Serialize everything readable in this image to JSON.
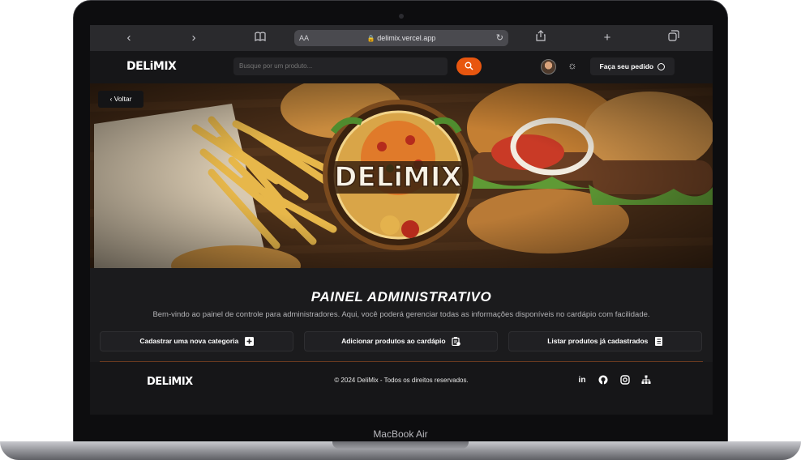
{
  "device": {
    "label": "MacBook Air"
  },
  "browser": {
    "url": "delimix.vercel.app",
    "aa_label": "AA",
    "back_icon": "chevron-left-icon",
    "forward_icon": "chevron-right-icon"
  },
  "header": {
    "logo": "DELiMIX",
    "search_placeholder": "Busque por um produto...",
    "order_label": "Faça seu pedido",
    "accent_color": "#e8560f"
  },
  "hero": {
    "back_label": "Voltar",
    "logo_text": "DELiMIX"
  },
  "main": {
    "title": "PAINEL ADMINISTRATIVO",
    "description": "Bem-vindo ao painel de controle para administradores. Aqui, você poderá gerenciar todas as informações disponíveis no cardápio com facilidade.",
    "actions": [
      {
        "label": "Cadastrar uma nova categoria",
        "icon": "plus-square-icon"
      },
      {
        "label": "Adicionar produtos ao cardápio",
        "icon": "clipboard-plus-icon"
      },
      {
        "label": "Listar produtos já cadastrados",
        "icon": "list-book-icon"
      }
    ]
  },
  "footer": {
    "logo": "DELiMIX",
    "copyright": "© 2024 DeliMix - Todos os direitos reservados.",
    "social": [
      "linkedin-icon",
      "github-icon",
      "instagram-icon",
      "sitemap-icon"
    ]
  }
}
